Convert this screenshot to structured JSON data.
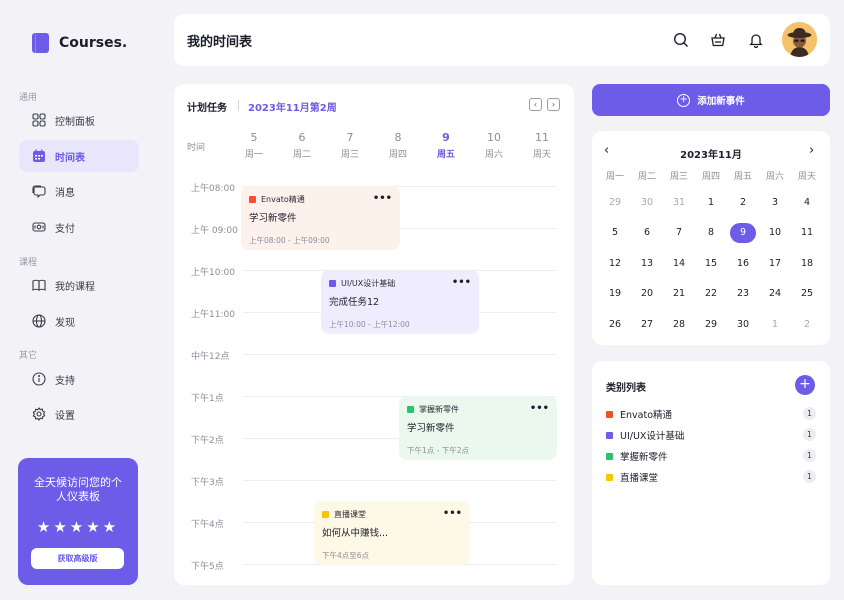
{
  "brand": {
    "name": "Courses."
  },
  "sidebar": {
    "sections": [
      {
        "label": "通用"
      },
      {
        "label": "课程"
      },
      {
        "label": "其它"
      }
    ],
    "items": [
      {
        "label": "控制面板",
        "icon": "dashboard-icon"
      },
      {
        "label": "时间表",
        "icon": "calendar-icon",
        "active": true
      },
      {
        "label": "消息",
        "icon": "message-icon"
      },
      {
        "label": "支付",
        "icon": "payment-icon"
      },
      {
        "label": "我的课程",
        "icon": "book-icon"
      },
      {
        "label": "发现",
        "icon": "globe-icon"
      },
      {
        "label": "支持",
        "icon": "info-icon"
      },
      {
        "label": "设置",
        "icon": "gear-icon"
      }
    ],
    "promo": {
      "title": "全天候访问您的个人仪表板",
      "stars": "★★★★★",
      "rating": 5,
      "button": "获取高级版"
    }
  },
  "header": {
    "title": "我的时间表",
    "icons": [
      "search-icon",
      "basket-icon",
      "bell-icon"
    ]
  },
  "schedule": {
    "label": "计划任务",
    "week": "2023年11月第2周",
    "prev": "‹",
    "next": "›",
    "time_header": "时间",
    "days": [
      {
        "num": "5",
        "name": "周一"
      },
      {
        "num": "6",
        "name": "周二"
      },
      {
        "num": "7",
        "name": "周三"
      },
      {
        "num": "8",
        "name": "周四"
      },
      {
        "num": "9",
        "name": "周五",
        "active": true
      },
      {
        "num": "10",
        "name": "周六"
      },
      {
        "num": "11",
        "name": "周天"
      }
    ],
    "times": [
      "上午08:00",
      "上午 09:00",
      "上午10:00",
      "上午11:00",
      "中午12点",
      "下午1点",
      "下午2点",
      "下午3点",
      "下午4点",
      "下午5点"
    ],
    "events": [
      {
        "tag": "Envato精通",
        "title": "学习新零件",
        "time": "上午08:00 - 上午09:00",
        "color": "#f0522b",
        "bg": "#fdf1ec"
      },
      {
        "tag": "UI/UX设计基础",
        "title": "完成任务12",
        "time": "上午10:00 - 上午12:00",
        "color": "#6c5ce7",
        "bg": "#efedfd"
      },
      {
        "tag": "掌握新零件",
        "title": "学习新零件",
        "time": "下午1点 - 下午2点",
        "color": "#2cc46b",
        "bg": "#eaf8ee"
      },
      {
        "tag": "直播课堂",
        "title": "如何从中赚钱...",
        "time": "下午4点至6点",
        "color": "#f7c600",
        "bg": "#fdf9e6"
      }
    ],
    "more": "•••"
  },
  "add_event": {
    "label": "添加新事件",
    "icon": "plus-circle-icon"
  },
  "calendar": {
    "title": "2023年11月",
    "prev": "‹",
    "next": "›",
    "weekdays": [
      "周一",
      "周二",
      "周三",
      "周四",
      "周五",
      "周六",
      "周天"
    ],
    "weeks": [
      [
        "29",
        "30",
        "31",
        "1",
        "2",
        "3",
        "4"
      ],
      [
        "5",
        "6",
        "7",
        "8",
        "9",
        "10",
        "11"
      ],
      [
        "12",
        "13",
        "14",
        "15",
        "16",
        "17",
        "18"
      ],
      [
        "19",
        "20",
        "21",
        "22",
        "23",
        "24",
        "25"
      ],
      [
        "26",
        "27",
        "28",
        "29",
        "30",
        "1",
        "2"
      ]
    ],
    "today": "9"
  },
  "categories": {
    "title": "类别列表",
    "add": "+",
    "items": [
      {
        "label": "Envato精通",
        "count": "1",
        "color": "#f0522b"
      },
      {
        "label": "UI/UX设计基础",
        "count": "1",
        "color": "#6c5ce7"
      },
      {
        "label": "掌握新零件",
        "count": "1",
        "color": "#2cc46b"
      },
      {
        "label": "直播课堂",
        "count": "1",
        "color": "#f7c600"
      }
    ]
  }
}
